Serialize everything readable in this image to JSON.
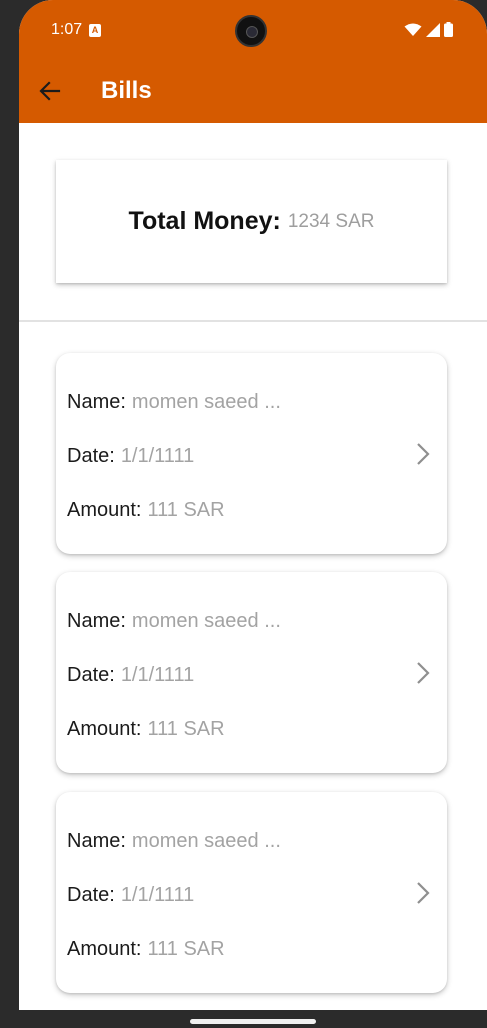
{
  "status_bar": {
    "time": "1:07",
    "notification_badge": "A"
  },
  "app_bar": {
    "title": "Bills",
    "back_icon": "arrow-back-icon",
    "color": "#d55a00"
  },
  "summary": {
    "label": "Total Money:",
    "value": "1234 SAR"
  },
  "bills": [
    {
      "name_label": "Name:",
      "name": "momen saeed ...",
      "date_label": "Date:",
      "date": "1/1/1111",
      "amount_label": "Amount:",
      "amount": "111 SAR"
    },
    {
      "name_label": "Name:",
      "name": "momen saeed ...",
      "date_label": "Date:",
      "date": "1/1/1111",
      "amount_label": "Amount:",
      "amount": "111 SAR"
    },
    {
      "name_label": "Name:",
      "name": "momen saeed ...",
      "date_label": "Date:",
      "date": "1/1/1111",
      "amount_label": "Amount:",
      "amount": "111 SAR"
    }
  ],
  "icons": {
    "chevron": "chevron-right-icon",
    "wifi": "wifi-icon",
    "signal": "signal-icon",
    "battery": "battery-icon"
  }
}
